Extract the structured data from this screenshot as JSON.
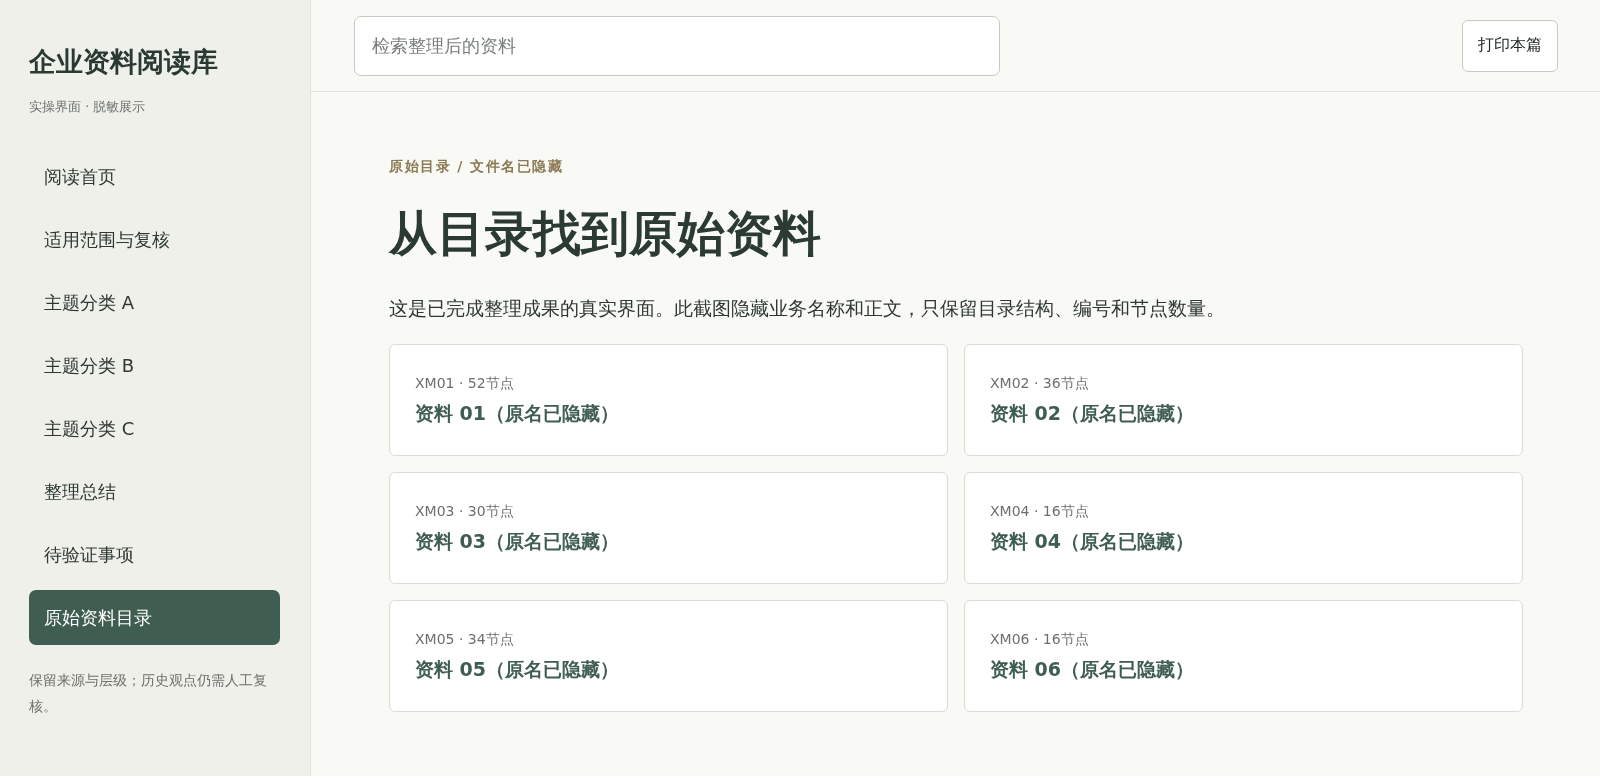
{
  "sidebar": {
    "title": "企业资料阅读库",
    "subtitle": "实操界面 · 脱敏展示",
    "items": [
      {
        "label": "阅读首页",
        "selected": false
      },
      {
        "label": "适用范围与复核",
        "selected": false
      },
      {
        "label": "主题分类 A",
        "selected": false
      },
      {
        "label": "主题分类 B",
        "selected": false
      },
      {
        "label": "主题分类 C",
        "selected": false
      },
      {
        "label": "整理总结",
        "selected": false
      },
      {
        "label": "待验证事项",
        "selected": false
      },
      {
        "label": "原始资料目录",
        "selected": true
      }
    ],
    "note": "保留来源与层级；历史观点仍需人工复核。"
  },
  "toolbar": {
    "search": {
      "placeholder": "检索整理后的资料"
    },
    "print_button": "打印本篇"
  },
  "breadcrumb": "原始目录 / 文件名已隐藏",
  "heading": "从目录找到原始资料",
  "intro": "这是已完成整理成果的真实界面。此截图隐藏业务名称和正文，只保留目录结构、编号和节点数量。",
  "cards": [
    {
      "meta": "XM01 · 52节点",
      "title": "资料 01（原名已隐藏）"
    },
    {
      "meta": "XM02 · 36节点",
      "title": "资料 02（原名已隐藏）"
    },
    {
      "meta": "XM03 · 30节点",
      "title": "资料 03（原名已隐藏）"
    },
    {
      "meta": "XM04 · 16节点",
      "title": "资料 04（原名已隐藏）"
    },
    {
      "meta": "XM05 · 34节点",
      "title": "资料 05（原名已隐藏）"
    },
    {
      "meta": "XM06 · 16节点",
      "title": "资料 06（原名已隐藏）"
    }
  ]
}
